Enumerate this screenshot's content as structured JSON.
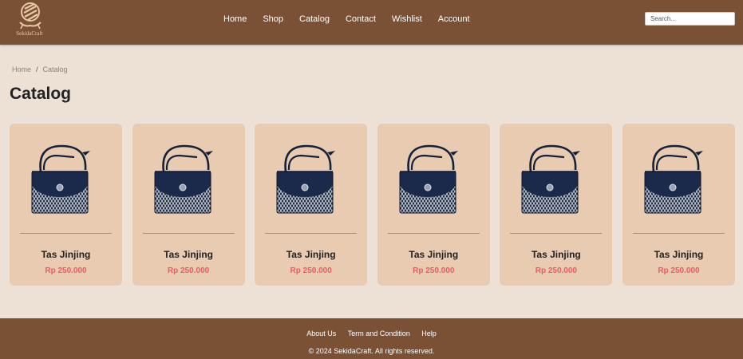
{
  "brand": {
    "name": "SekidaCraft",
    "colors": {
      "header_bg": "#7b5136",
      "page_bg": "#ede1d6",
      "card_bg": "#e8cbb1",
      "price": "#f0596c",
      "logo": "#e9c9a3"
    }
  },
  "nav": {
    "items": [
      {
        "label": "Home"
      },
      {
        "label": "Shop"
      },
      {
        "label": "Catalog"
      },
      {
        "label": "Contact"
      },
      {
        "label": "Wishlist"
      },
      {
        "label": "Account"
      }
    ]
  },
  "search": {
    "placeholder": "Search..."
  },
  "breadcrumb": {
    "home": "Home",
    "separator": "/",
    "current": "Catalog"
  },
  "page": {
    "title": "Catalog"
  },
  "products": [
    {
      "name": "Tas Jinjing",
      "price": "Rp 250.000",
      "image_icon": "handbag-image"
    },
    {
      "name": "Tas Jinjing",
      "price": "Rp 250.000",
      "image_icon": "handbag-image"
    },
    {
      "name": "Tas Jinjing",
      "price": "Rp 250.000",
      "image_icon": "handbag-image"
    },
    {
      "name": "Tas Jinjing",
      "price": "Rp 250.000",
      "image_icon": "handbag-image"
    },
    {
      "name": "Tas Jinjing",
      "price": "Rp 250.000",
      "image_icon": "handbag-image"
    },
    {
      "name": "Tas Jinjing",
      "price": "Rp 250.000",
      "image_icon": "handbag-image"
    }
  ],
  "footer": {
    "links": [
      {
        "label": "About Us"
      },
      {
        "label": "Term and Condition"
      },
      {
        "label": "Help"
      }
    ],
    "copyright": "© 2024 SekidaCraft. All rights reserved."
  }
}
